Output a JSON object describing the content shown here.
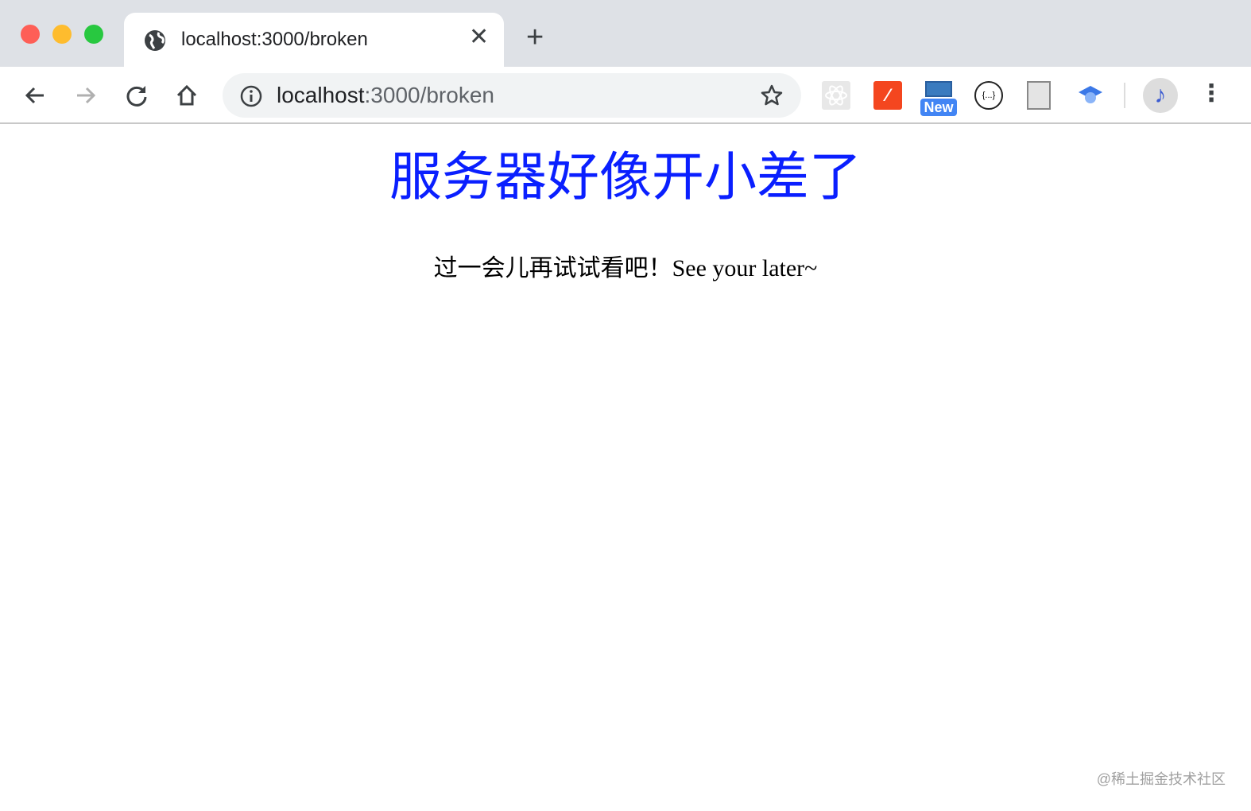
{
  "window": {
    "traffic_lights": {
      "close": "#fe5f57",
      "minimize": "#febc2e",
      "maximize": "#28c840"
    }
  },
  "tab": {
    "title": "localhost:3000/broken",
    "close_icon": "close-icon"
  },
  "new_tab_icon": "plus-icon",
  "address_bar": {
    "host": "localhost",
    "rest": ":3000/broken"
  },
  "extensions": {
    "new_badge": "New",
    "code_badge": "{...}"
  },
  "page": {
    "heading": "服务器好像开小差了",
    "message": "过一会儿再试试看吧！See your later~",
    "heading_color": "#0a1fff"
  },
  "watermark": "@稀土掘金技术社区"
}
